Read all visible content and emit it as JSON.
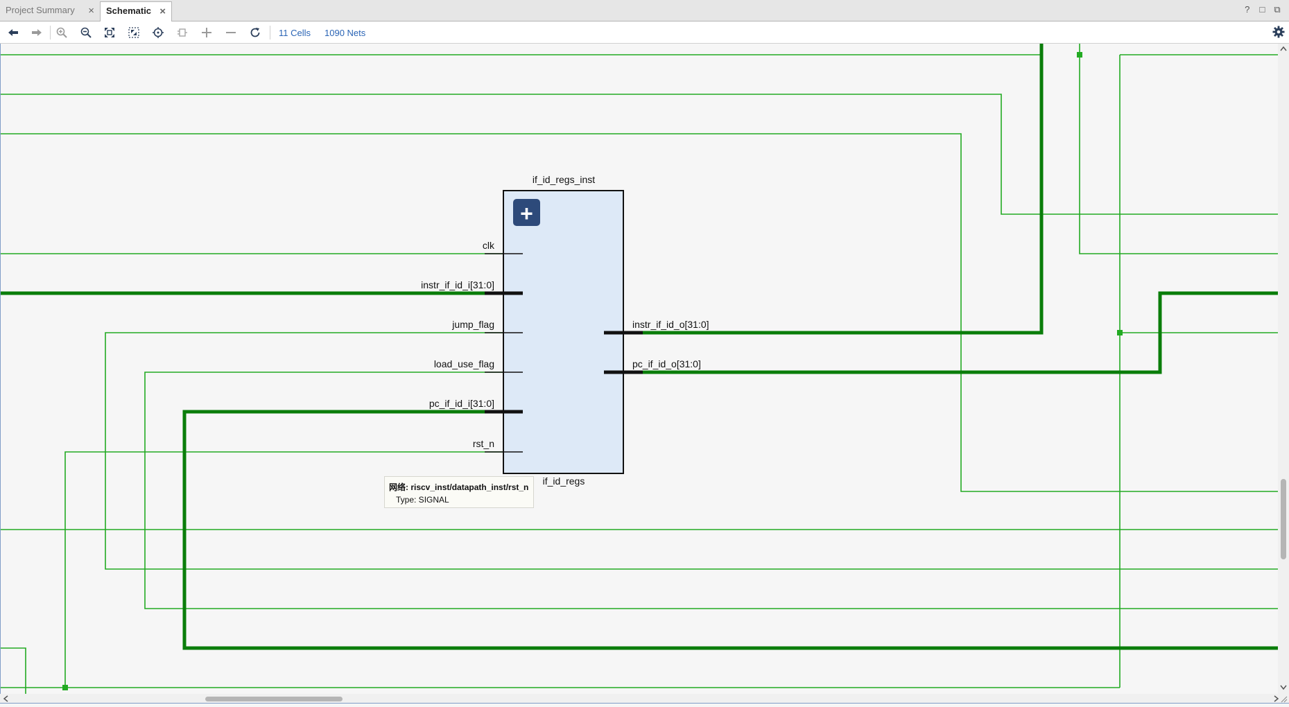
{
  "tabs": [
    {
      "label": "Project Summary",
      "close": "×"
    },
    {
      "label": "Schematic",
      "close": "×"
    }
  ],
  "window_controls": [
    "?",
    "□",
    "⧉"
  ],
  "toolbar": {
    "buttons": [
      "back-icon",
      "forward-icon",
      "zoom-in-icon",
      "zoom-out-icon",
      "zoom-fit-icon",
      "zoom-area-icon",
      "autofit-selection-icon",
      "select-icon",
      "expand-icon",
      "collapse-icon",
      "reload-icon"
    ],
    "cells_link": "11 Cells",
    "nets_link": "1090 Nets",
    "settings": "gear-icon"
  },
  "schematic": {
    "instance_name": "if_id_regs_inst",
    "cell_type": "if_id_regs",
    "expand_symbol": "+",
    "inputs": [
      "clk",
      "instr_if_id_i[31:0]",
      "jump_flag",
      "load_use_flag",
      "pc_if_id_i[31:0]",
      "rst_n"
    ],
    "outputs": [
      "instr_if_id_o[31:0]",
      "pc_if_id_o[31:0]"
    ],
    "colors": {
      "net": "#22aa22",
      "bus": "#0a7d0a",
      "cell_fill": "#dde9f7",
      "cell_border": "#111111",
      "expand_button": "#2d4a7a"
    }
  },
  "tooltip": {
    "net_label": "网络: riscv_inst/datapath_inst/rst_n",
    "type_label": "Type: SIGNAL"
  }
}
